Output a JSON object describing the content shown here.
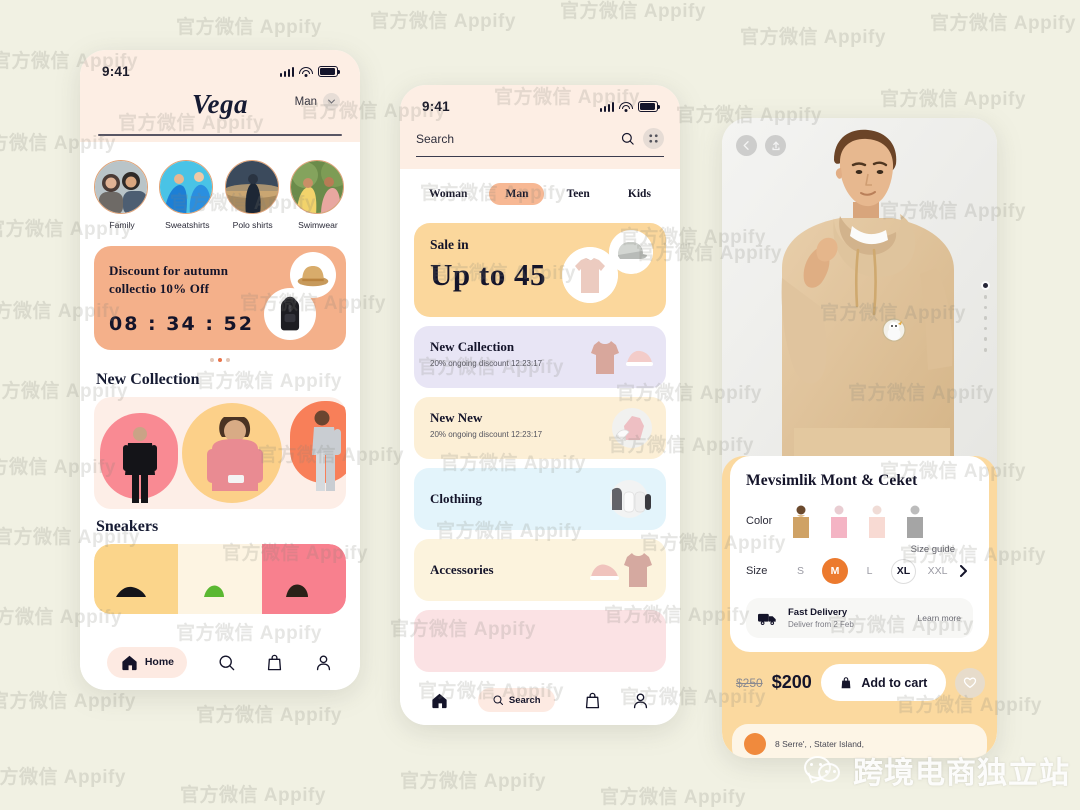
{
  "background_color": "#f1f1e3",
  "watermark": {
    "text": "官方微信 Appify",
    "brand_text": "跨境电商独立站",
    "brand_icon": "wechat-icon"
  },
  "phone1": {
    "status_bar": {
      "time": "9:41",
      "signal_icon": "signal-bars-icon",
      "wifi_icon": "wifi-icon",
      "battery_icon": "battery-icon"
    },
    "header": {
      "logo": "Vega",
      "segment_label": "Man",
      "chevron_icon": "chevron-down-icon"
    },
    "categories": [
      {
        "label": "Family",
        "image": "family-photo"
      },
      {
        "label": "Sweatshirts",
        "image": "sweatshirts-photo"
      },
      {
        "label": "Polo shirts",
        "image": "polo-shirts-photo"
      },
      {
        "label": "Swimwear",
        "image": "swimwear-photo"
      }
    ],
    "banner": {
      "line1": "Discount for autumn",
      "line2": "collectio 10% Off",
      "timer": "08 : 34 : 52",
      "bg_color": "#f4b08a",
      "item1_icon": "bucket-hat",
      "item2_icon": "backpack",
      "dots": 5,
      "active_dot": 2
    },
    "sections": [
      {
        "title": "New Collection"
      },
      {
        "title": "Sneakers"
      }
    ],
    "collection_colors": [
      "#f98a93",
      "#fcd089",
      "#f87f59"
    ],
    "sneaker_colors": [
      "#fbd58b",
      "#fdf4e2",
      "#f8808e"
    ],
    "tabbar": {
      "items": [
        {
          "label": "Home",
          "icon": "home-icon",
          "active": true
        },
        {
          "label": "",
          "icon": "search-icon",
          "active": false
        },
        {
          "label": "",
          "icon": "bag-icon",
          "active": false
        },
        {
          "label": "",
          "icon": "user-icon",
          "active": false
        }
      ]
    }
  },
  "phone2": {
    "status_bar": {
      "time": "9:41"
    },
    "search": {
      "placeholder": "Search",
      "search_icon": "search-icon",
      "filter_icon": "filter-icon"
    },
    "tabs": [
      {
        "label": "Woman",
        "active": false
      },
      {
        "label": "Man",
        "active": true
      },
      {
        "label": "Teen",
        "active": false
      },
      {
        "label": "Kids",
        "active": false
      }
    ],
    "sale_card": {
      "eyebrow": "Sale in",
      "headline": "Up to 45",
      "bg_color": "#fbd79c",
      "item1_icon": "cap",
      "item2_icon": "tshirt"
    },
    "category_cards": [
      {
        "title": "New Callection",
        "subtitle": "20% ongoing discount 12:23:17",
        "bg_color": "#e8e5f5"
      },
      {
        "title": "New New",
        "subtitle": "20% ongoing discount 12:23:17",
        "bg_color": "#fcefd6"
      },
      {
        "title": "Clothiing",
        "subtitle": "",
        "bg_color": "#e3f4fb"
      },
      {
        "title": "Accessories",
        "subtitle": "",
        "bg_color": "#fcf3dd"
      },
      {
        "title": "",
        "subtitle": "",
        "bg_color": "#fbe2e4"
      }
    ],
    "tabbar": {
      "items": [
        {
          "label": "",
          "icon": "home-icon",
          "active": false
        },
        {
          "label": "Search",
          "icon": "search-icon",
          "active": true
        },
        {
          "label": "",
          "icon": "bag-icon",
          "active": false
        },
        {
          "label": "",
          "icon": "user-icon",
          "active": false
        }
      ]
    }
  },
  "phone3": {
    "hero": {
      "back_icon": "chevron-left-icon",
      "share_icon": "share-upload-icon",
      "image": "model-wearing-beige-hoodie",
      "dots_total": 7,
      "active_dot": 1
    },
    "product": {
      "title": "Mevsimlik Mont & Ceket",
      "color_label": "Color",
      "colors": [
        "#d3a877",
        "#f3b8c4",
        "#f6d8d4",
        "#a9a9a9"
      ],
      "size_label": "Size",
      "size_guide": "Size guide",
      "sizes": [
        {
          "label": "S",
          "state": "plain"
        },
        {
          "label": "M",
          "state": "active"
        },
        {
          "label": "L",
          "state": "plain"
        },
        {
          "label": "XL",
          "state": "outline"
        },
        {
          "label": "XXL",
          "state": "plain"
        }
      ],
      "next_icon": "chevron-right-icon",
      "delivery": {
        "icon": "truck-icon",
        "title": "Fast Delivery",
        "subtitle": "Deliver from 2 Feb",
        "link": "Learn more"
      },
      "price_old": "$250",
      "price_new": "$200",
      "cta_label": "Add to cart",
      "cta_icon": "bag-icon",
      "favorite_icon": "heart-icon",
      "accent_color": "#ec7a2e",
      "sheet_color": "#fbd99f"
    },
    "footer": {
      "address": "8 Serre', , Stater Island,",
      "avatar": "seller-avatar"
    }
  }
}
